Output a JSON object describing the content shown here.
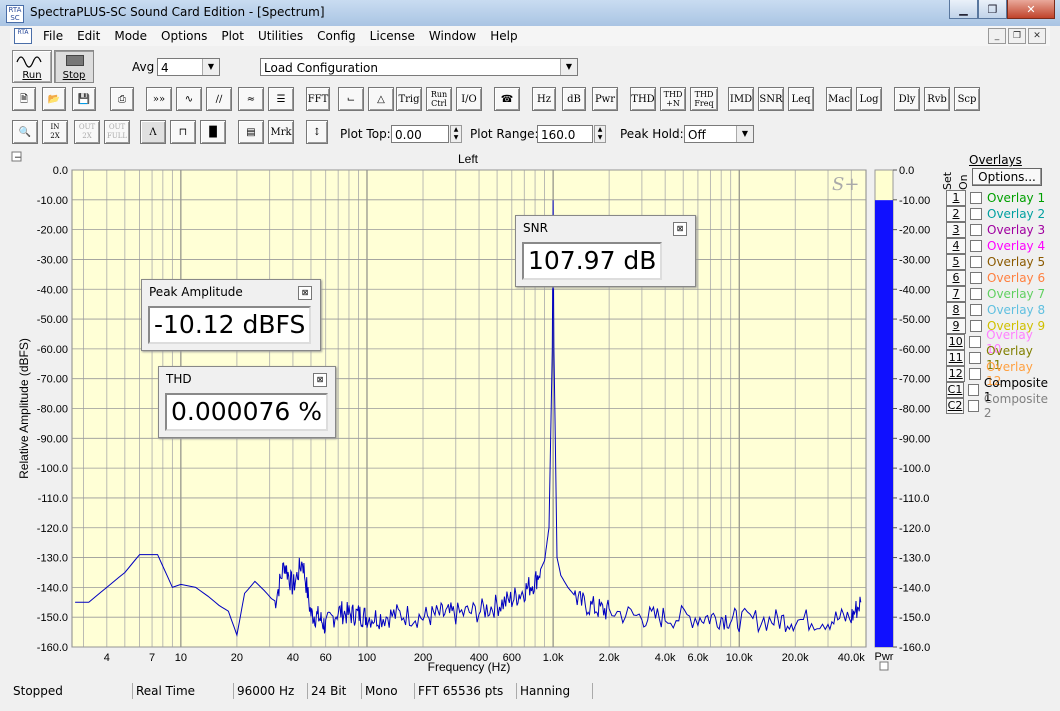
{
  "app": {
    "title": "SpectraPLUS-SC Sound Card Edition - [Spectrum]",
    "icon": "spectraplus-icon",
    "caption_buttons": [
      "minimize",
      "restore",
      "close"
    ]
  },
  "menu": [
    "File",
    "Edit",
    "Mode",
    "Options",
    "Plot",
    "Utilities",
    "Config",
    "License",
    "Window",
    "Help"
  ],
  "toolbar1": {
    "run_label": "Run",
    "stop_label": "Stop",
    "avg_label": "Avg",
    "avg_value": "4",
    "config_value": "Load Configuration"
  },
  "toolbar2": {
    "icon_buttons": [
      "new-file",
      "open-file",
      "save",
      "print",
      "fast-forward",
      "edit-wave",
      "sweep",
      "signal-gen",
      "waterfall"
    ],
    "text_buttons": [
      "FFT",
      "Trig",
      "Run Ctrl",
      "I/O",
      "Hz",
      "dB",
      "Pwr",
      "THD",
      "THD +N",
      "THD Freq",
      "IMD",
      "SNR",
      "Leq",
      "Mac",
      "Log",
      "Dly",
      "Rvb",
      "Scp"
    ]
  },
  "toolbar3": {
    "mrk_label": "Mrk",
    "plot_top_label": "Plot Top:",
    "plot_top_value": "0.00",
    "plot_range_label": "Plot Range:",
    "plot_range_value": "160.0",
    "peak_hold_label": "Peak Hold:",
    "peak_hold_value": "Off"
  },
  "plot": {
    "channel": "Left",
    "watermark": "S+",
    "y_label": "Relative Amplitude (dBFS)",
    "x_label": "Frequency (Hz)",
    "y_ticks": [
      "0.0",
      "-10.00",
      "-20.00",
      "-30.00",
      "-40.00",
      "-50.00",
      "-60.00",
      "-70.00",
      "-80.00",
      "-90.00",
      "-100.0",
      "-110.0",
      "-120.0",
      "-130.0",
      "-140.0",
      "-150.0",
      "-160.0"
    ],
    "x_ticks": [
      "4",
      "7",
      "10",
      "20",
      "40",
      "60",
      "100",
      "200",
      "400",
      "600",
      "1.0k",
      "2.0k",
      "4.0k",
      "6.0k",
      "10.0k",
      "20.0k",
      "40.0k"
    ],
    "bar_ticks": [
      "0.0",
      "-10.00",
      "-20.00",
      "-30.00",
      "-40.00",
      "-50.00",
      "-60.00",
      "-70.00",
      "-80.00",
      "-90.00",
      "-100.0",
      "-110.0",
      "-120.0",
      "-130.0",
      "-140.0",
      "-150.0",
      "-160.0"
    ],
    "bar_label": "Pwr",
    "power_level_dbfs": -10.12,
    "trace_color": "#0000c0",
    "plot_bg": "#ffffd6"
  },
  "popups": [
    {
      "title": "Peak Amplitude",
      "value": "-10.12 dBFS"
    },
    {
      "title": "THD",
      "value": "0.000076 %"
    },
    {
      "title": "SNR",
      "value": "107.97 dB"
    }
  ],
  "overlays": {
    "title": "Overlays",
    "set_label": "Set",
    "on_label": "On",
    "options_label": "Options...",
    "items": [
      {
        "num": "1",
        "label": "Overlay 1",
        "color": "#00a000"
      },
      {
        "num": "2",
        "label": "Overlay 2",
        "color": "#00a0a0"
      },
      {
        "num": "3",
        "label": "Overlay 3",
        "color": "#a000a0"
      },
      {
        "num": "4",
        "label": "Overlay 4",
        "color": "#ff00ff"
      },
      {
        "num": "5",
        "label": "Overlay 5",
        "color": "#8b5a00"
      },
      {
        "num": "6",
        "label": "Overlay 6",
        "color": "#ff8040"
      },
      {
        "num": "7",
        "label": "Overlay 7",
        "color": "#60d060"
      },
      {
        "num": "8",
        "label": "Overlay 8",
        "color": "#60c0e0"
      },
      {
        "num": "9",
        "label": "Overlay 9",
        "color": "#d0c000"
      },
      {
        "num": "10",
        "label": "Overlay 10",
        "color": "#ff80ff"
      },
      {
        "num": "11",
        "label": "Overlay 11",
        "color": "#808000"
      },
      {
        "num": "12",
        "label": "Overlay 12",
        "color": "#ffa040"
      },
      {
        "num": "C1",
        "label": "Composite 1",
        "color": "#000000"
      },
      {
        "num": "C2",
        "label": "Composite 2",
        "color": "#808080"
      }
    ]
  },
  "status": [
    "Stopped",
    "Real Time",
    "96000 Hz",
    "24 Bit",
    "Mono",
    "FFT 65536 pts",
    "Hanning"
  ],
  "chart_data": {
    "type": "line",
    "title": "Left",
    "xlabel": "Frequency (Hz)",
    "ylabel": "Relative Amplitude (dBFS)",
    "x_scale": "log",
    "xlim": [
      2.6,
      48000
    ],
    "ylim": [
      -160,
      0
    ],
    "grid": true,
    "series": [
      {
        "x": [
          2.7,
          3.2,
          4,
          5,
          6,
          7.5,
          9,
          10,
          12,
          14,
          16,
          18,
          20,
          22,
          25,
          28,
          32,
          36,
          40,
          45,
          50,
          55,
          60,
          70,
          80,
          90,
          100,
          120,
          150,
          200,
          250,
          300,
          400,
          500,
          600,
          700,
          800,
          900,
          950,
          990,
          1000,
          1010,
          1050,
          1100,
          1200,
          1400,
          1700,
          2000,
          3000,
          4000,
          6000,
          8000,
          10000,
          15000,
          20000,
          30000,
          40000,
          45000
        ],
        "y": [
          -145,
          -145,
          -140,
          -135,
          -129,
          -129,
          -140,
          -139,
          -140,
          -143,
          -146,
          -148,
          -156,
          -142,
          -138,
          -141,
          -145,
          -132,
          -140,
          -131,
          -149,
          -150,
          -153,
          -148,
          -149,
          -149,
          -150,
          -150,
          -149,
          -150,
          -149,
          -149,
          -148,
          -146,
          -144,
          -141,
          -138,
          -131,
          -120,
          -60,
          -10.12,
          -60,
          -130,
          -136,
          -140,
          -145,
          -147,
          -148,
          -150,
          -150,
          -150,
          -150,
          -151,
          -151,
          -151,
          -151,
          -150,
          -145
        ]
      }
    ]
  }
}
